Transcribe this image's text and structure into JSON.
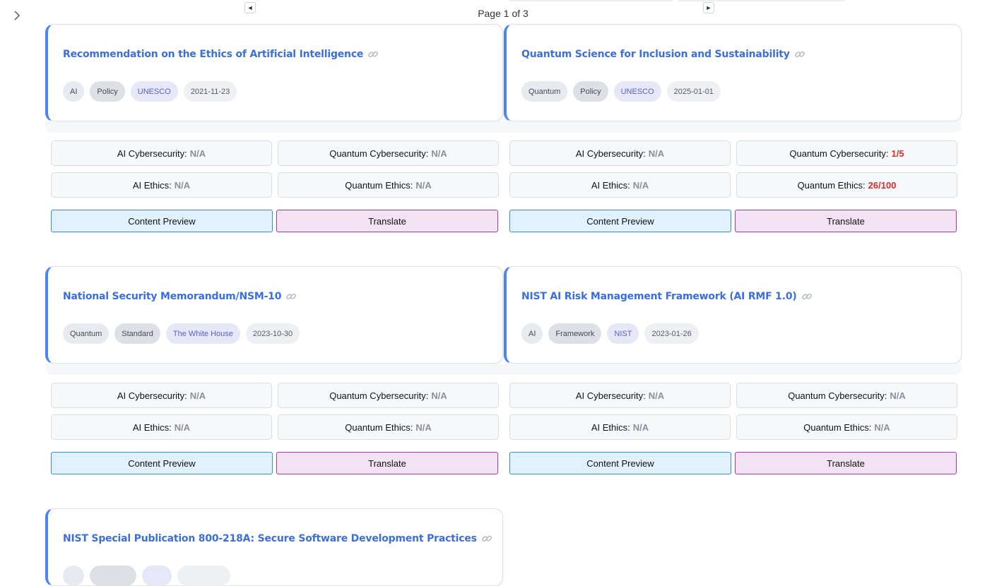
{
  "pagination": {
    "prev_symbol": "◄",
    "next_symbol": "►",
    "page_text": "Page 1 of 3"
  },
  "labels": {
    "ai_cyber": "AI Cybersecurity:",
    "q_cyber": "Quantum Cybersecurity:",
    "ai_ethics": "AI Ethics:",
    "q_ethics": "Quantum Ethics:",
    "preview": "Content Preview",
    "translate": "Translate"
  },
  "colors": {
    "accent": "#4a84f5",
    "title": "#3a6fe0",
    "score_alert": "#d62d2d",
    "preview_bg": "#e1f1fd",
    "translate_bg": "#f2e2f3"
  },
  "documents": [
    {
      "title": "Recommendation on the Ethics of Artificial Intelligence",
      "topic": "AI",
      "type": "Policy",
      "org": "UNESCO",
      "date": "2021-11-23",
      "scores": {
        "ai_cyber": "N/A",
        "q_cyber": "N/A",
        "ai_ethics": "N/A",
        "q_ethics": "N/A"
      }
    },
    {
      "title": "Quantum Science for Inclusion and Sustainability",
      "topic": "Quantum",
      "type": "Policy",
      "org": "UNESCO",
      "date": "2025-01-01",
      "scores": {
        "ai_cyber": "N/A",
        "q_cyber": "1/5",
        "ai_ethics": "N/A",
        "q_ethics": "26/100"
      }
    },
    {
      "title": "National Security Memorandum/NSM-10",
      "topic": "Quantum",
      "type": "Standard",
      "org": "The White House",
      "date": "2023-10-30",
      "scores": {
        "ai_cyber": "N/A",
        "q_cyber": "N/A",
        "ai_ethics": "N/A",
        "q_ethics": "N/A"
      }
    },
    {
      "title": "NIST AI Risk Management Framework (AI RMF 1.0)",
      "topic": "AI",
      "type": "Framework",
      "org": "NIST",
      "date": "2023-01-26",
      "scores": {
        "ai_cyber": "N/A",
        "q_cyber": "N/A",
        "ai_ethics": "N/A",
        "q_ethics": "N/A"
      }
    },
    {
      "title": "NIST Special Publication 800-218A: Secure Software Development Practices"
    }
  ]
}
